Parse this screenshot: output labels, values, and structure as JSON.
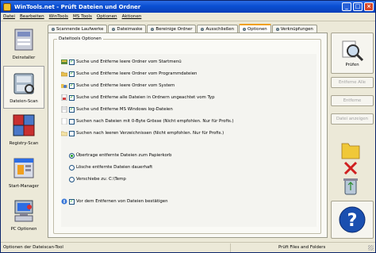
{
  "window": {
    "title": "WinTools.net - Prüft Dateien und Ordner"
  },
  "menu": [
    "Datei",
    "Bearbeiten",
    "WinTools",
    "MS Tools",
    "Optionen",
    "Aktionen"
  ],
  "sidebar": {
    "items": [
      {
        "label": "Deinstaller",
        "icon": "uninstaller-icon"
      },
      {
        "label": "Dateien-Scan",
        "icon": "file-scan-icon"
      },
      {
        "label": "Registry-Scan",
        "icon": "registry-scan-icon"
      },
      {
        "label": "Start-Manager",
        "icon": "startup-manager-icon"
      },
      {
        "label": "PC Optionen",
        "icon": "pc-options-icon"
      }
    ]
  },
  "tabs": [
    "Scannende Laufwerke",
    "Dateimaske",
    "Bereinige Ordner",
    "Ausschließen",
    "Optionen",
    "Verknüpfungen"
  ],
  "selected_tab": "Optionen",
  "options": {
    "group_title": "Dateitools Optionen",
    "checkboxes": [
      {
        "label": "Suche und Entferne leere Ordner vom Startmenü",
        "checked": true,
        "icon": "startmenu-folder-icon"
      },
      {
        "label": "Suche und Entferne leere Ordner vom Programmdateien",
        "checked": true,
        "icon": "folder-icon"
      },
      {
        "label": "Suche und Entferne leere Ordner vom System",
        "checked": true,
        "icon": "system-folder-icon"
      },
      {
        "label": "Suche und Entferne alle Dateien in Ordnern ungeachtet vom Typ",
        "checked": true,
        "icon": "file-type-icon"
      },
      {
        "label": "Suche und Entferne MS Windows log-Dateien",
        "checked": true,
        "icon": "log-file-icon"
      },
      {
        "label": "Suchen nach Dateien mit 0-Byte Grösse (Nicht empfohlen. Nur für Profis.)",
        "checked": false,
        "icon": "empty-file-icon"
      },
      {
        "label": "Suchen nach leeren Verzeichnissen (Nicht empfohlen. Nur für Profis.)",
        "checked": false,
        "icon": "empty-folder-icon"
      }
    ],
    "radios": [
      {
        "label": "Übertrage entfernte Dateien zum Papierkorb",
        "selected": true
      },
      {
        "label": "Lösche entfernte Dateien dauerhaft",
        "selected": false
      },
      {
        "label": "Verschiebe zu: C:\\Temp",
        "selected": false
      }
    ],
    "confirm": {
      "label": "Vor dem Entfernen von Dateien bestätigen",
      "checked": true,
      "icon": "confirm-icon"
    }
  },
  "actions": {
    "check": "Prüfen",
    "remove_all": "Entferne Alle",
    "remove": "Entferne",
    "show_file": "Datei anzeigen"
  },
  "status": {
    "left": "Optionen der Dateiscan-Tool",
    "right": "Prüft Files and Folders"
  },
  "colors": {
    "title_bar": "#0a4fd2",
    "check_mark": "#21a121",
    "help_button": "#1a4fb0"
  }
}
